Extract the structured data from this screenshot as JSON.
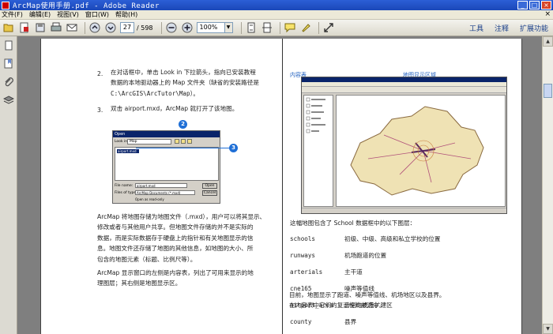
{
  "window": {
    "title": "ArcMap使用手册.pdf - Adobe Reader",
    "minimize": "_",
    "maximize": "□",
    "close": "×"
  },
  "menu": {
    "items": [
      "文件(F)",
      "编辑(E)",
      "视图(V)",
      "窗口(W)",
      "帮助(H)"
    ],
    "close": "×"
  },
  "toolbar": {
    "page_current": "27",
    "page_total": "/ 598",
    "zoom": "100%",
    "zoom_arrow": "▼",
    "right_tools": [
      "工具",
      "注释",
      "扩展功能"
    ]
  },
  "scrollbar": {
    "up": "▲",
    "down": "▼"
  },
  "left_column": {
    "item2_num": "2.",
    "item2_lines": [
      "在对话框中，单击 Look in 下拉箭头，指向已安装教程",
      "数据的本地驱动器上的 Map 文件夹（缺省的安装路径是",
      "C:\\ArcGIS\\ArcTutor\\Map）。"
    ],
    "item3_num": "3.",
    "item3_line": "双击 airport.mxd，ArcMap 就打开了该地图。",
    "para1": [
      "ArcMap 将地图存储为地图文件（.mxd），用户可以将其显示、",
      "修改或者与其他用户共享。但地图文件存储的并不是实际的",
      "数据，而是实际数据存于硬盘上的指针和有关地图显示的信",
      "息。地图文件还存储了地图的其他信息，如地图的大小、所",
      "包含的地图元素（标题、比例尺等）。"
    ],
    "para2": [
      "ArcMap 显示窗口的左侧是内容表，列出了可用来显示的地",
      "理图层；其右侧是地图显示区。"
    ]
  },
  "dialog": {
    "title": "Open",
    "look_in_label": "Look in:",
    "look_in_value": "Map",
    "selected_file": "airport.mxd",
    "filename_label": "File name:",
    "filename_value": "airport.mxd",
    "filetype_label": "Files of type:",
    "filetype_value": "ArcMap Documents (*.mxd)",
    "readonly_label": "Open as read-only",
    "open_button": "Open",
    "cancel_button": "Cancel",
    "callout_2": "2",
    "callout_3": "3"
  },
  "right_column": {
    "label_toc": "内容表",
    "label_mapview": "地图显示区域",
    "intro": "这幅地图包含了 School 数据框中的以下图层：",
    "layers": [
      {
        "name": "schools",
        "desc": "初级、中级、高级和私立学校的位置"
      },
      {
        "name": "runways",
        "desc": "机场跑道的位置"
      },
      {
        "name": "arterials",
        "desc": "主干道"
      },
      {
        "name": "cne165",
        "desc": "噪声等值线"
      },
      {
        "name": "airport_area",
        "desc": "计划的机场扩建区"
      },
      {
        "name": "county",
        "desc": "县界"
      }
    ],
    "outro": [
      "目前，地图显示了跑道、噪声等值线、机场地区以及县界。",
      "在内容表中它们的复选框均被选中。"
    ]
  },
  "colors": {
    "titlebar": "#1a47b8",
    "callout": "#1f6fd6",
    "annotation": "#1f5fbf",
    "map_fill": "#efe2b4"
  }
}
